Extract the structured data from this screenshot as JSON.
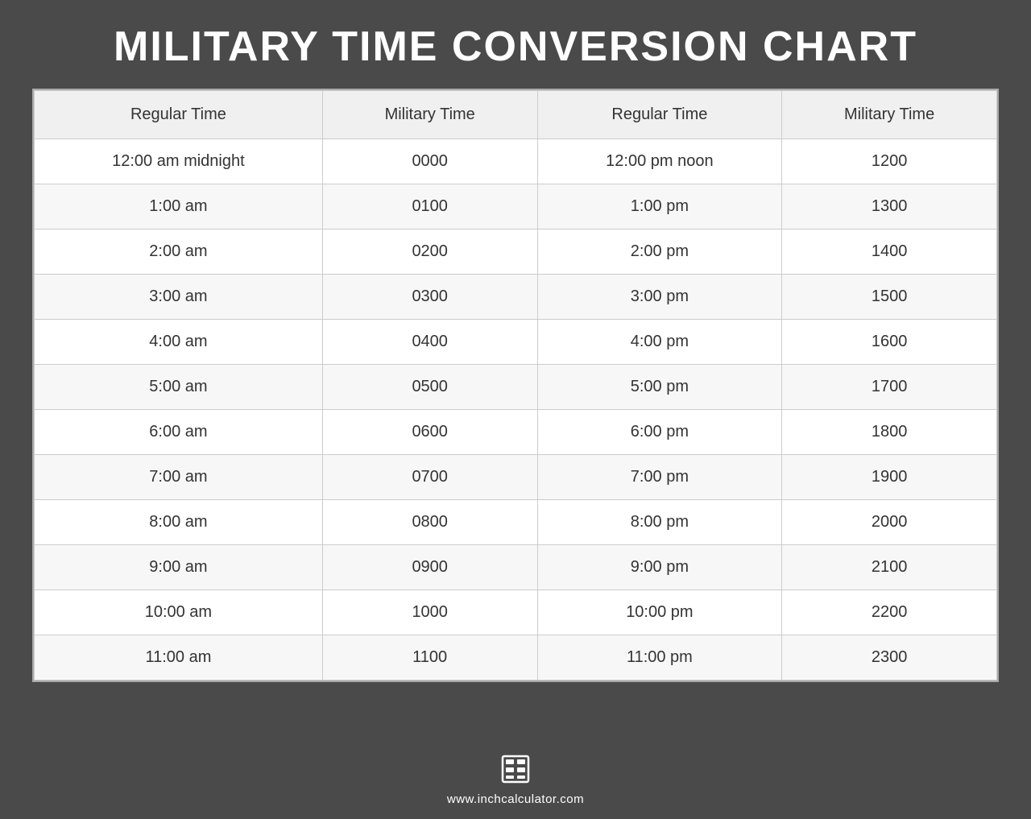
{
  "header": {
    "title": "MILITARY TIME CONVERSION CHART"
  },
  "table": {
    "columns": [
      "Regular Time",
      "Military Time",
      "Regular Time",
      "Military Time"
    ],
    "rows": [
      {
        "regular_am": "12:00 am midnight",
        "military_am": "0000",
        "regular_pm": "12:00 pm noon",
        "military_pm": "1200"
      },
      {
        "regular_am": "1:00 am",
        "military_am": "0100",
        "regular_pm": "1:00 pm",
        "military_pm": "1300"
      },
      {
        "regular_am": "2:00 am",
        "military_am": "0200",
        "regular_pm": "2:00 pm",
        "military_pm": "1400"
      },
      {
        "regular_am": "3:00 am",
        "military_am": "0300",
        "regular_pm": "3:00 pm",
        "military_pm": "1500"
      },
      {
        "regular_am": "4:00 am",
        "military_am": "0400",
        "regular_pm": "4:00 pm",
        "military_pm": "1600"
      },
      {
        "regular_am": "5:00 am",
        "military_am": "0500",
        "regular_pm": "5:00 pm",
        "military_pm": "1700"
      },
      {
        "regular_am": "6:00 am",
        "military_am": "0600",
        "regular_pm": "6:00 pm",
        "military_pm": "1800"
      },
      {
        "regular_am": "7:00 am",
        "military_am": "0700",
        "regular_pm": "7:00 pm",
        "military_pm": "1900"
      },
      {
        "regular_am": "8:00 am",
        "military_am": "0800",
        "regular_pm": "8:00 pm",
        "military_pm": "2000"
      },
      {
        "regular_am": "9:00 am",
        "military_am": "0900",
        "regular_pm": "9:00 pm",
        "military_pm": "2100"
      },
      {
        "regular_am": "10:00 am",
        "military_am": "1000",
        "regular_pm": "10:00 pm",
        "military_pm": "2200"
      },
      {
        "regular_am": "11:00 am",
        "military_am": "1100",
        "regular_pm": "11:00 pm",
        "military_pm": "2300"
      }
    ]
  },
  "footer": {
    "url": "www.inchcalculator.com"
  }
}
